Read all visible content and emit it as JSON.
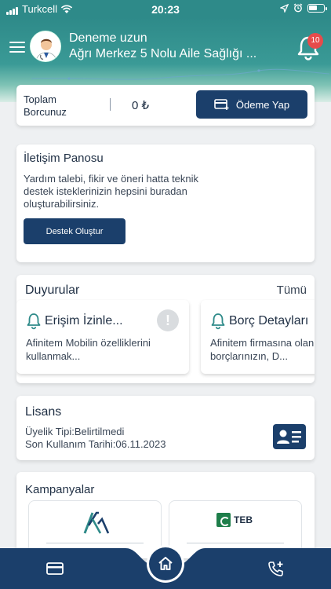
{
  "status_bar": {
    "carrier": "Turkcell",
    "time": "20:23"
  },
  "header": {
    "user_name": "Deneme uzun",
    "organization": "Ağrı Merkez 5 Nolu Aile Sağlığı ...",
    "notification_count": "10"
  },
  "debt": {
    "label_line1": "Toplam",
    "label_line2": "Borcunuz",
    "amount": "0 ₺",
    "pay_button": "Ödeme Yap"
  },
  "contact_board": {
    "title": "İletişim Panosu",
    "description": "Yardım talebi, fikir ve öneri hatta teknik destek isteklerinizin hepsini buradan oluşturabilirsiniz.",
    "button": "Destek Oluştur"
  },
  "announcements": {
    "title": "Duyurular",
    "see_all": "Tümü",
    "items": [
      {
        "title": "Erişim İzinle...",
        "text_line1": "Afinitem Mobilin özelliklerini",
        "text_line2": "kullanmak..."
      },
      {
        "title": "Borç Detayları",
        "text_line1": "Afinitem firmasına olan",
        "text_line2": "borçlarınızın, D..."
      }
    ]
  },
  "license": {
    "title": "Lisans",
    "membership": "Üyelik Tipi:Belirtilmedi",
    "last_use": "Son Kullanım Tarihi:06.11.2023"
  },
  "campaigns": {
    "title": "Kampanyalar",
    "items": [
      {
        "logo": "afinitem-logo"
      },
      {
        "logo": "teb-logo",
        "name": "TEB"
      }
    ]
  },
  "icons": {
    "menu": "menu-icon",
    "bell": "bell-icon",
    "card": "credit-card-icon",
    "home": "home-icon",
    "phone": "phone-add-icon"
  },
  "colors": {
    "primary": "#1b3f6b",
    "header": "#2e8a89",
    "badge": "#e74b4b"
  }
}
